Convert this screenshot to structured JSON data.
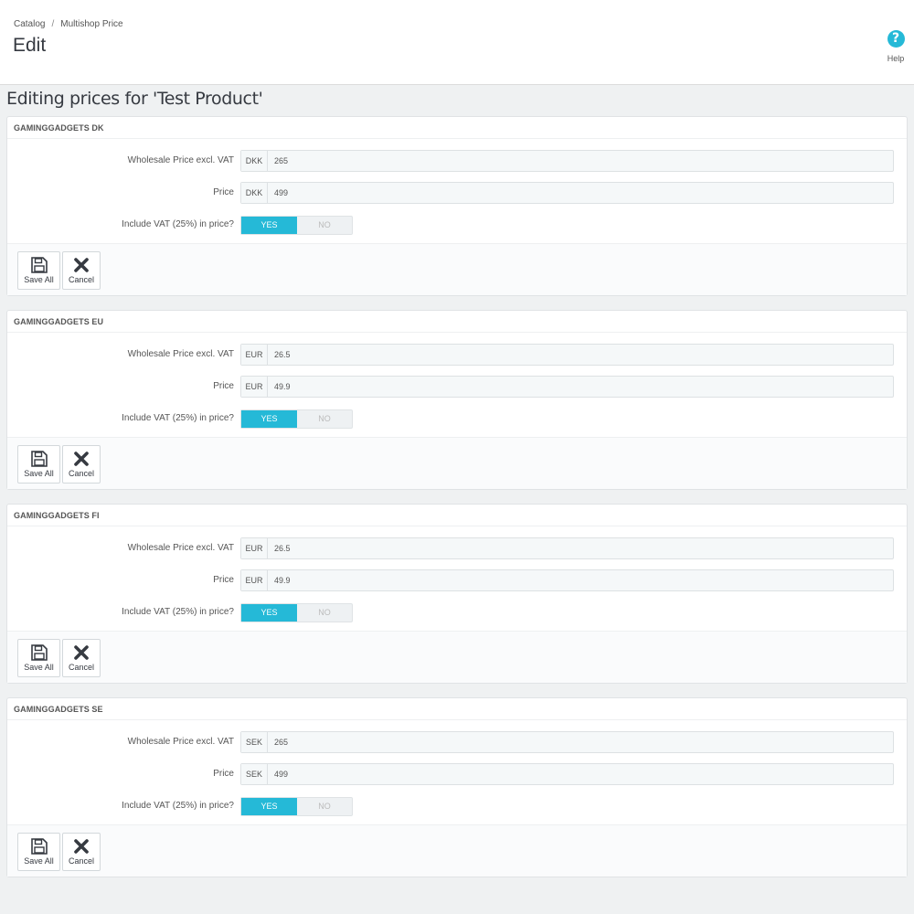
{
  "breadcrumb": {
    "parent": "Catalog",
    "current": "Multishop Price"
  },
  "page_title": "Edit",
  "help_label": "Help",
  "section_title": "Editing prices for 'Test Product'",
  "labels": {
    "wholesale": "Wholesale Price excl. VAT",
    "price": "Price",
    "vat": "Include VAT (25%) in price?",
    "yes": "YES",
    "no": "NO",
    "save": "Save All",
    "cancel": "Cancel"
  },
  "shops": [
    {
      "name": "GAMINGGADGETS DK",
      "currency": "DKK",
      "wholesale": "265",
      "price": "499",
      "vat_included": true
    },
    {
      "name": "GAMINGGADGETS EU",
      "currency": "EUR",
      "wholesale": "26.5",
      "price": "49.9",
      "vat_included": true
    },
    {
      "name": "GAMINGGADGETS FI",
      "currency": "EUR",
      "wholesale": "26.5",
      "price": "49.9",
      "vat_included": true
    },
    {
      "name": "GAMINGGADGETS SE",
      "currency": "SEK",
      "wholesale": "265",
      "price": "499",
      "vat_included": true
    }
  ],
  "colors": {
    "accent": "#25b9d7",
    "background": "#eff1f2"
  }
}
